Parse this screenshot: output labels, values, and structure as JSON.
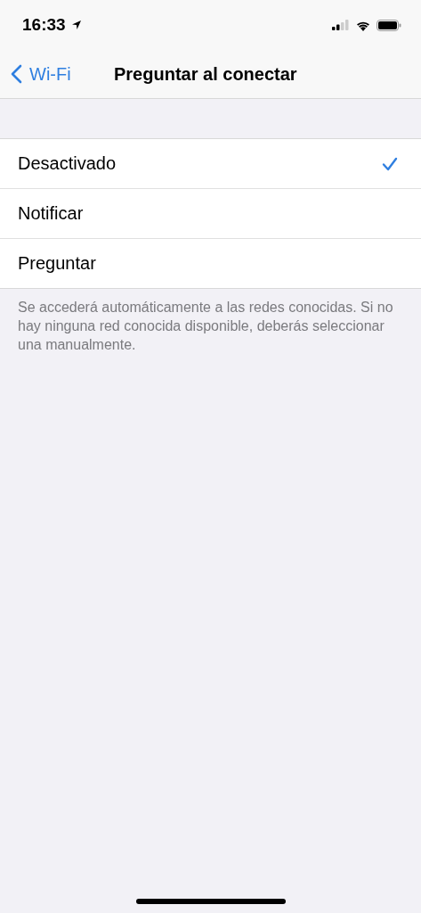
{
  "status_bar": {
    "time": "16:33"
  },
  "nav": {
    "back": "Wi-Fi",
    "title": "Preguntar al conectar"
  },
  "options": [
    {
      "label": "Desactivado",
      "selected": true
    },
    {
      "label": "Notificar",
      "selected": false
    },
    {
      "label": "Preguntar",
      "selected": false
    }
  ],
  "footer": "Se accederá automáticamente a las redes conocidas. Si no hay ninguna red conocida disponible, deberás seleccionar una manualmente."
}
